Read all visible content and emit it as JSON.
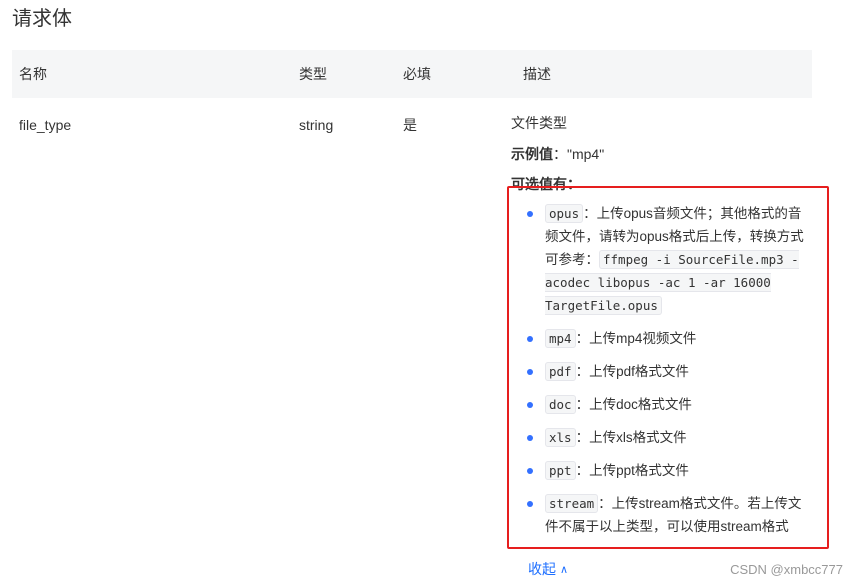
{
  "section": {
    "title": "请求体"
  },
  "table": {
    "headers": {
      "name": "名称",
      "type": "类型",
      "required": "必填",
      "description": "描述"
    },
    "row": {
      "name": "file_type",
      "type": "string",
      "required": "是",
      "desc_title": "文件类型",
      "example_label": "示例值",
      "example_value": "：\"mp4\"",
      "options_label": "可选值有："
    }
  },
  "options": [
    {
      "code": "opus",
      "text": "：上传opus音频文件；其他格式的音频文件，请转为opus格式后上传，转换方式可参考：",
      "extra_code": "ffmpeg -i SourceFile.mp3 -acodec libopus -ac 1 -ar 16000 TargetFile.opus"
    },
    {
      "code": "mp4",
      "text": "：上传mp4视频文件"
    },
    {
      "code": "pdf",
      "text": "：上传pdf格式文件"
    },
    {
      "code": "doc",
      "text": "：上传doc格式文件"
    },
    {
      "code": "xls",
      "text": "：上传xls格式文件"
    },
    {
      "code": "ppt",
      "text": "：上传ppt格式文件"
    },
    {
      "code": "stream",
      "text": "：上传stream格式文件。若上传文件不属于以上类型，可以使用stream格式"
    }
  ],
  "collapse": {
    "label": "收起",
    "icon": "chevron-up-icon"
  },
  "watermark": "CSDN @xmbcc777",
  "colors": {
    "accent": "#1e6fff",
    "highlight_border": "#e61e1e",
    "bullet": "#3370ff"
  }
}
